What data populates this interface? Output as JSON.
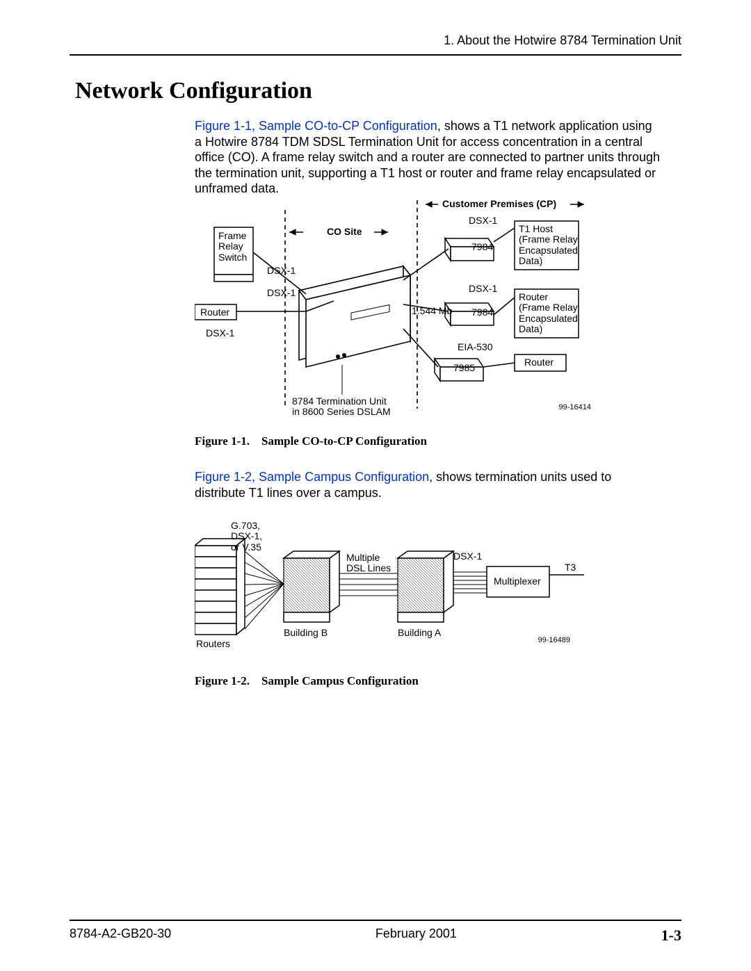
{
  "header": {
    "chapter": "1. About the Hotwire 8784 Termination Unit"
  },
  "title": "Network Configuration",
  "paragraph1": {
    "link": "Figure 1-1, Sample CO-to-CP Configuration",
    "rest": ", shows a T1 network application using a Hotwire 8784 TDM SDSL Termination Unit for access concentration in a central office (CO). A frame relay switch and a router are connected to partner units through the termination unit, supporting a T1 host or router and frame relay encapsulated or unframed data."
  },
  "figure1": {
    "caption_prefix": "Figure 1-1.",
    "caption_text": "Sample CO-to-CP Configuration",
    "labels": {
      "cp_header": "Customer Premises (CP)",
      "co_site": "CO Site",
      "frame_relay_switch": "Frame\nRelay\nSwitch",
      "router_left": "Router",
      "dsx1_a": "DSX-1",
      "dsx1_b": "DSX-1",
      "dsx1_c": "DSX-1",
      "rate": "1.544 Mb",
      "unit_caption": "8784 Termination Unit\nin 8600 Series DSLAM",
      "dsx1_cp1": "DSX-1",
      "dev_7984_1": "7984",
      "t1host": "T1 Host\n(Frame Relay\nEncapsulated\nData)",
      "dsx1_cp2": "DSX-1",
      "dev_7984_2": "7984",
      "router_fr": "Router\n(Frame Relay\nEncapsulated\nData)",
      "eia530": "EIA-530",
      "dev_7985": "7985",
      "router_right": "Router",
      "drawing_id": "99-16414"
    }
  },
  "paragraph2": {
    "link": "Figure 1-2, Sample Campus Configuration",
    "rest": ", shows termination units used to distribute T1 lines over a campus."
  },
  "figure2": {
    "caption_prefix": "Figure 1-2.",
    "caption_text": "Sample Campus Configuration",
    "labels": {
      "g703": "G.703,\nDSX-1,\nor V.35",
      "routers": "Routers",
      "building_b": "Building B",
      "multi_dsl": "Multiple\nDSL Lines",
      "building_a": "Building A",
      "dsx1": "DSX-1",
      "multiplexer": "Multiplexer",
      "t3": "T3",
      "drawing_id": "99-16489"
    }
  },
  "footer": {
    "doc_id": "8784-A2-GB20-30",
    "date": "February 2001",
    "page": "1-3"
  }
}
